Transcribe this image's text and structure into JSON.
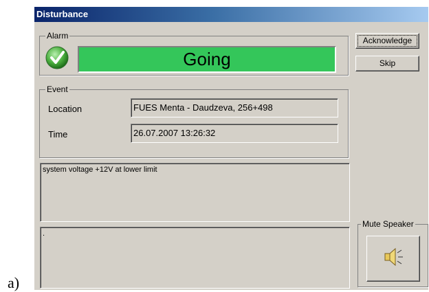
{
  "caption": "a)",
  "window": {
    "title": "Disturbance"
  },
  "alarm": {
    "legend": "Alarm",
    "status": "Going",
    "status_color": "#34c65a",
    "icon": "check-icon"
  },
  "event": {
    "legend": "Event",
    "location_label": "Location",
    "location_value": "FUES Menta - Daudzeva, 256+498",
    "time_label": "Time",
    "time_value": "26.07.2007  13:26:32"
  },
  "message": {
    "text": "system voltage +12V at lower limit"
  },
  "notes": {
    "text": "."
  },
  "buttons": {
    "acknowledge": "Acknowledge",
    "skip": "Skip"
  },
  "mute": {
    "legend": "Mute Speaker",
    "icon": "speaker-icon"
  }
}
